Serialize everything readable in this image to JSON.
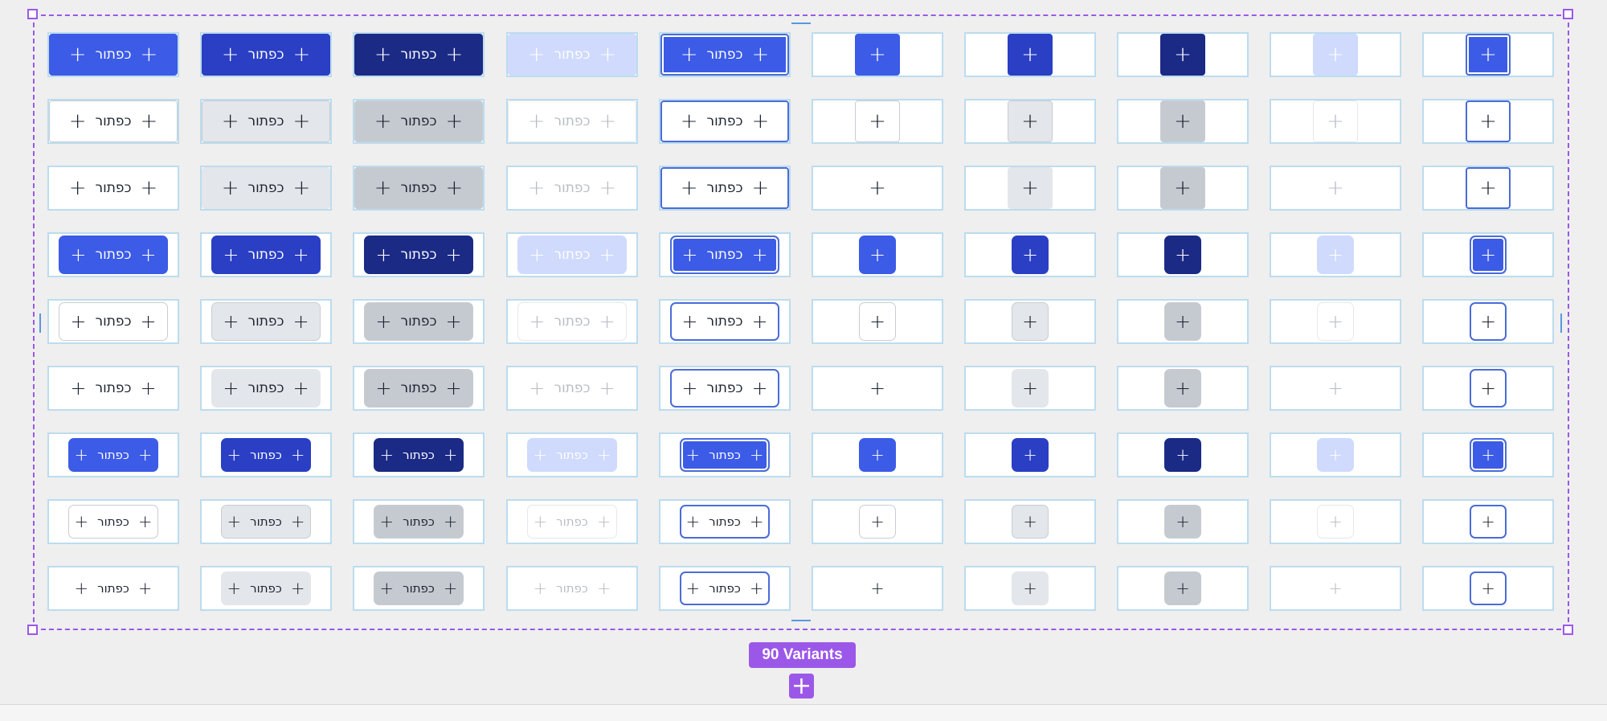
{
  "button": {
    "label": "כפתור",
    "icon": "+",
    "icon_name": "plus-icon"
  },
  "variants_badge": "90 Variants",
  "add_variant": {
    "icon": "+",
    "icon_name": "plus-icon"
  },
  "colors": {
    "frame": "#9b58e8",
    "cell_border": "#bcdcef",
    "primary": "#3c5be6",
    "primary_hover": "#2a3fc4",
    "primary_pressed": "#1b2a85",
    "primary_disabled": "#cfdafd",
    "secondary_border": "#c9ccd1",
    "secondary_hover": "#e3e6ea",
    "secondary_pressed": "#c5cad1",
    "focus_ring": "#4a6cd8",
    "text_dark": "#1d2430",
    "text_disabled": "#b8bdc4"
  },
  "grid": {
    "columns": [
      {
        "state": "default",
        "icon_only": false
      },
      {
        "state": "hover",
        "icon_only": false
      },
      {
        "state": "pressed",
        "icon_only": false
      },
      {
        "state": "disabled",
        "icon_only": false
      },
      {
        "state": "focus",
        "icon_only": false
      },
      {
        "state": "default",
        "icon_only": true
      },
      {
        "state": "hover",
        "icon_only": true
      },
      {
        "state": "pressed",
        "icon_only": true
      },
      {
        "state": "disabled",
        "icon_only": true
      },
      {
        "state": "focus",
        "icon_only": true
      }
    ],
    "rows": [
      {
        "variant": "primary",
        "size": "large"
      },
      {
        "variant": "secondary",
        "size": "large"
      },
      {
        "variant": "ghost",
        "size": "large"
      },
      {
        "variant": "primary",
        "size": "medium"
      },
      {
        "variant": "secondary",
        "size": "medium"
      },
      {
        "variant": "ghost",
        "size": "medium"
      },
      {
        "variant": "primary",
        "size": "small"
      },
      {
        "variant": "secondary",
        "size": "small"
      },
      {
        "variant": "ghost",
        "size": "small"
      }
    ]
  }
}
